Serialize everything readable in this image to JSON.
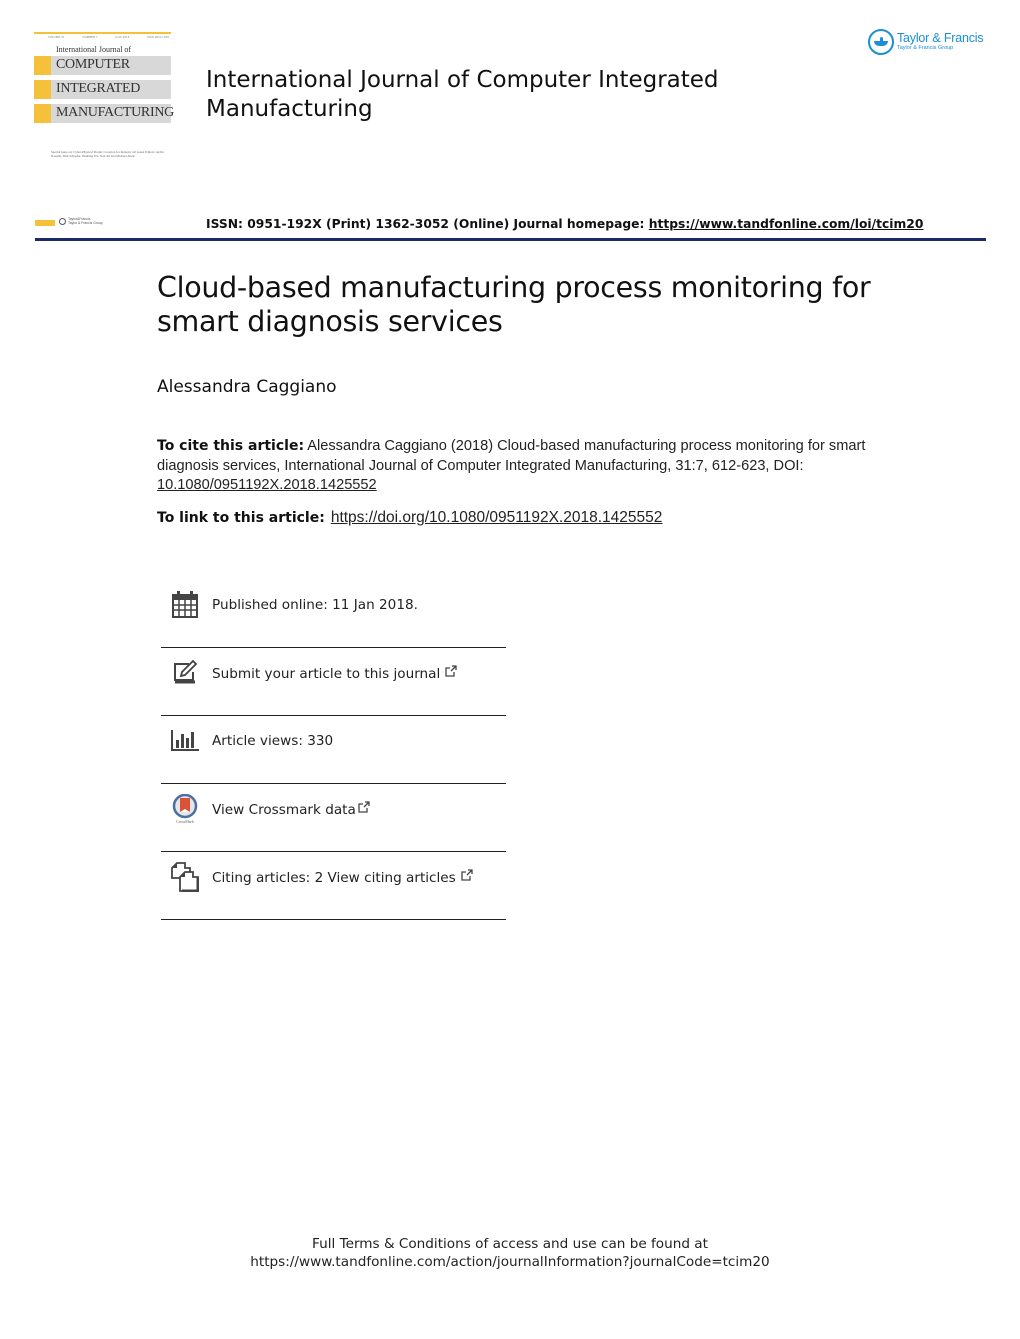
{
  "cover": {
    "meta": [
      "VOLUME 31",
      "NUMBER 7",
      "JULY 2018",
      "ISSN 0951-192X"
    ],
    "intl": "International Journal of",
    "bands": [
      "COMPUTER",
      "INTEGRATED",
      "MANUFACTURING"
    ],
    "special": "Special issue on: Cyber-Physical Product Creation for Industry 4.0 Guest Editors: Aydin Nassehi, Dirk Schaefer, Dunbing Wu, Xun Xu and Michael Abele",
    "accent_color": "#f6c13a"
  },
  "journal_title": "International Journal of Computer Integrated Manufacturing",
  "publisher_logo": {
    "name": "Taylor & Francis",
    "subtitle": "Taylor & Francis Group",
    "icon": "lamp-icon",
    "color": "#1a8fd6"
  },
  "issn_row": {
    "text": "ISSN: 0951-192X (Print) 1362-3052 (Online) Journal homepage: ",
    "homepage_url": "https://www.tandfonline.com/loi/tcim20"
  },
  "mini_logo": {
    "name": "Taylor&Francis",
    "subtitle": "Taylor & Francis Group"
  },
  "article": {
    "title": "Cloud-based manufacturing process monitoring for smart diagnosis services",
    "author": "Alessandra Caggiano"
  },
  "cite": {
    "label": "To cite this article:",
    "text": " Alessandra Caggiano (2018) Cloud-based manufacturing process monitoring for smart diagnosis services, International Journal of Computer Integrated Manufacturing, 31:7, 612-623, DOI: ",
    "doi": "10.1080/0951192X.2018.1425552"
  },
  "link": {
    "label": "To link to this article:",
    "url": "https://doi.org/10.1080/0951192X.2018.1425552"
  },
  "info_items": [
    {
      "icon": "calendar-icon",
      "label": "Published online: 11 Jan 2018.",
      "external": false
    },
    {
      "icon": "edit-icon",
      "label": "Submit your article to this journal",
      "external": true
    },
    {
      "icon": "bar-chart-icon",
      "label": "Article views: 330",
      "external": false
    },
    {
      "icon": "crossmark-icon",
      "label": "View Crossmark data",
      "external": true
    },
    {
      "icon": "citing-articles-icon",
      "label": "Citing articles: 2 View citing articles",
      "external": true
    }
  ],
  "footer": {
    "line1": "Full Terms & Conditions of access and use can be found at",
    "line2": "https://www.tandfonline.com/action/journalInformation?journalCode=tcim20"
  },
  "colors": {
    "rule": "#1b2a6b",
    "accent": "#f6c13a",
    "brand": "#1a8fd6"
  }
}
